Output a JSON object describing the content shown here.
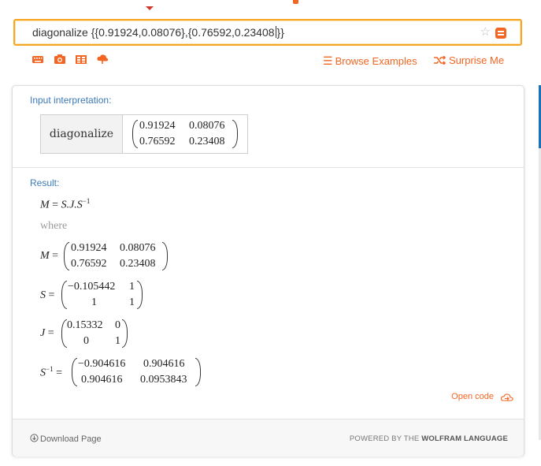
{
  "search": {
    "query_before_caret": "diagonalize {{0.91924,0.08076},{0.76592,0.23408",
    "query_after_caret": "}}"
  },
  "toolbar": {
    "icons": [
      "keyboard-icon",
      "camera-icon",
      "table-icon",
      "upload-icon"
    ],
    "browse_label": "Browse Examples",
    "surprise_label": "Surprise Me"
  },
  "pods": {
    "input_title": "Input interpretation:",
    "input_op": "diagonalize",
    "input_matrix": [
      [
        "0.91924",
        "0.08076"
      ],
      [
        "0.76592",
        "0.23408"
      ]
    ],
    "result_title": "Result:",
    "result_formula": {
      "lhs": "M",
      "eq": "=",
      "rhs": "S.J.S",
      "sup": "−1"
    },
    "where_label": "where",
    "M": {
      "name": "M",
      "rows": [
        [
          "0.91924",
          "0.08076"
        ],
        [
          "0.76592",
          "0.23408"
        ]
      ]
    },
    "S": {
      "name": "S",
      "rows": [
        [
          "−0.105442",
          "1"
        ],
        [
          "1",
          "1"
        ]
      ]
    },
    "J": {
      "name": "J",
      "rows": [
        [
          "0.15332",
          "0"
        ],
        [
          "0",
          "1"
        ]
      ]
    },
    "Sinv": {
      "name": "S",
      "sup": "−1",
      "rows": [
        [
          "−0.904616",
          "0.904616"
        ],
        [
          "0.904616",
          "0.0953843"
        ]
      ]
    }
  },
  "open_code_label": "Open code",
  "footer": {
    "download_label": "Download Page",
    "powered_prefix": "POWERED BY THE",
    "powered_brand": "WOLFRAM LANGUAGE"
  },
  "colors": {
    "accent": "#f26522",
    "search_border": "#f5a623",
    "pod_title": "#3d7ab8"
  }
}
